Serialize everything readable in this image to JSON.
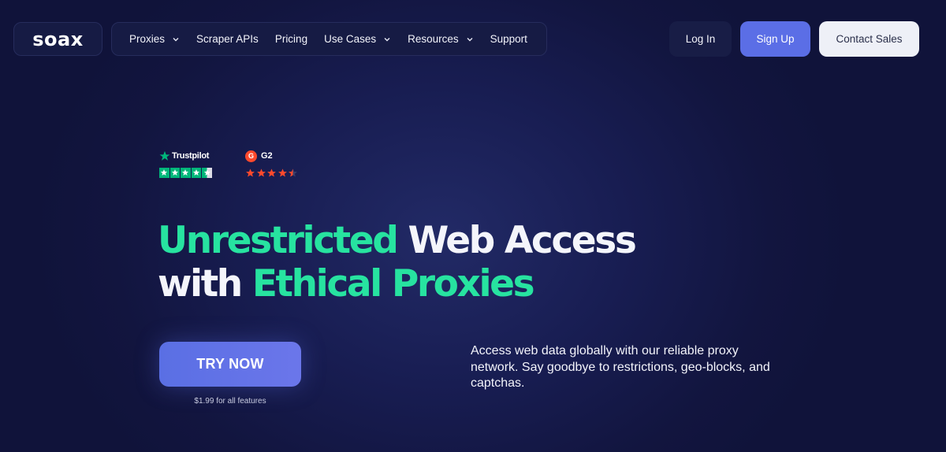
{
  "header": {
    "logo": "soax",
    "nav": [
      {
        "label": "Proxies",
        "dropdown": true
      },
      {
        "label": "Scraper APIs",
        "dropdown": false
      },
      {
        "label": "Pricing",
        "dropdown": false
      },
      {
        "label": "Use Cases",
        "dropdown": true
      },
      {
        "label": "Resources",
        "dropdown": true
      },
      {
        "label": "Support",
        "dropdown": false
      }
    ],
    "login_label": "Log In",
    "signup_label": "Sign Up",
    "contact_label": "Contact Sales"
  },
  "ratings": {
    "trustpilot": {
      "name": "Trustpilot",
      "stars": 4.5,
      "color": "#00b67a"
    },
    "g2": {
      "name": "G2",
      "logo_letter": "G",
      "stars": 4.5,
      "color": "#ff492c"
    }
  },
  "hero": {
    "headline_line1_accent": "Unrestricted",
    "headline_line1_rest": "Web Access",
    "headline_line2_start": "with",
    "headline_line2_accent": "Ethical Proxies",
    "cta_label": "TRY NOW",
    "price_note": "$1.99 for all features",
    "subtext": "Access web data globally with our reliable proxy network. Say goodbye to restrictions, geo-blocks, and captchas."
  },
  "colors": {
    "background": "#12153f",
    "accent_green": "#27e3a0",
    "primary_blue": "#5b6ee6"
  }
}
